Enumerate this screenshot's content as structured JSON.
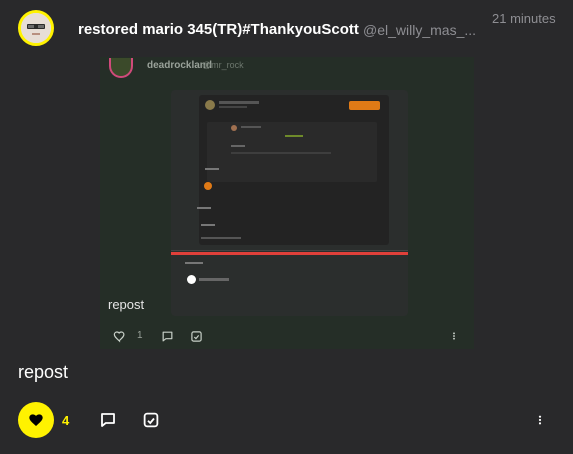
{
  "post": {
    "author_name": "restored mario 345(TR)#ThankyouScott",
    "author_handle": "@el_willy_mas_...",
    "timestamp": "21 minutes",
    "text": "repost",
    "like_count": "4",
    "liked": true
  },
  "embedded_post": {
    "author_name": "deadrockland",
    "author_handle": "@mr_rock",
    "text": "repost",
    "like_count": "1"
  },
  "colors": {
    "background": "#29292b",
    "accent": "#fff200",
    "embed_background": "#252e27",
    "muted_text": "#8e8e93"
  },
  "icons": {
    "like": "heart-icon",
    "comment": "comment-icon",
    "quote": "quote-icon",
    "more": "more-vertical-icon"
  }
}
